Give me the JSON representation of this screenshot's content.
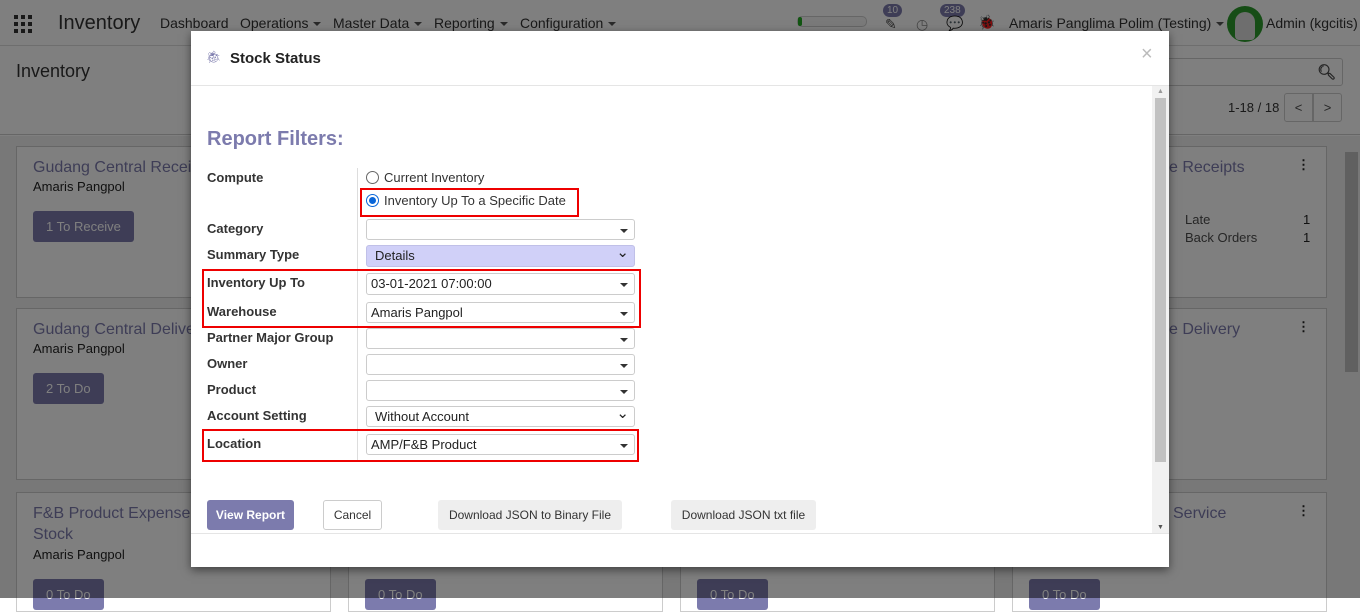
{
  "navbar": {
    "app_title": "Inventory",
    "menus": [
      "Dashboard",
      "Operations",
      "Master Data",
      "Reporting",
      "Configuration"
    ],
    "activity_count": "10",
    "message_count": "238",
    "company": "Amaris Panglima Polim (Testing)",
    "user": "Admin (kgcitis)",
    "colors": {
      "accent": "#7c7bad"
    }
  },
  "control_panel": {
    "breadcrumb": "Inventory",
    "pager": "1-18 / 18"
  },
  "kanban": [
    {
      "title": "Gudang Central Receipts",
      "title_visible_left": "Gudang Central Recei",
      "subtitle": "Amaris Pangpol",
      "button": "1 To Receive"
    },
    {
      "title_visible_right": "e Receipts",
      "stats": [
        {
          "label": "Late",
          "value": "1"
        },
        {
          "label": "Back Orders",
          "value": "1"
        }
      ]
    },
    {
      "title_visible_left": "Gudang Central Delive",
      "subtitle": "Amaris Pangpol",
      "button": "2 To Do"
    },
    {
      "title_visible_right": "e Delivery"
    },
    {
      "title_visible_left": "F&B Product Expense",
      "title_line2": "Stock",
      "subtitle": "Amaris Pangpol",
      "button": "0 To Do"
    },
    {
      "title_visible_right": "Service"
    },
    {
      "button": "0 To Do"
    },
    {
      "button": "0 To Do"
    },
    {
      "button": "0 To Do"
    }
  ],
  "modal": {
    "title": "Stock Status",
    "close": "×",
    "section_title": "Report Filters:",
    "compute": {
      "label": "Compute",
      "options": [
        "Current Inventory",
        "Inventory Up To a Specific Date"
      ],
      "selected": "Inventory Up To a Specific Date"
    },
    "fields": [
      {
        "label": "Category",
        "value": ""
      },
      {
        "label": "Summary Type",
        "value": "Details"
      },
      {
        "label": "Inventory Up To",
        "value": "03-01-2021 07:00:00"
      },
      {
        "label": "Warehouse",
        "value": "Amaris Pangpol"
      },
      {
        "label": "Partner Major Group",
        "value": ""
      },
      {
        "label": "Owner",
        "value": ""
      },
      {
        "label": "Product",
        "value": ""
      },
      {
        "label": "Account Setting",
        "value": "Without Account"
      },
      {
        "label": "Location",
        "value": "AMP/F&B Product"
      }
    ],
    "buttons": {
      "view": "View Report",
      "cancel": "Cancel",
      "json_binary": "Download JSON to Binary File",
      "json_txt": "Download JSON txt file"
    }
  }
}
